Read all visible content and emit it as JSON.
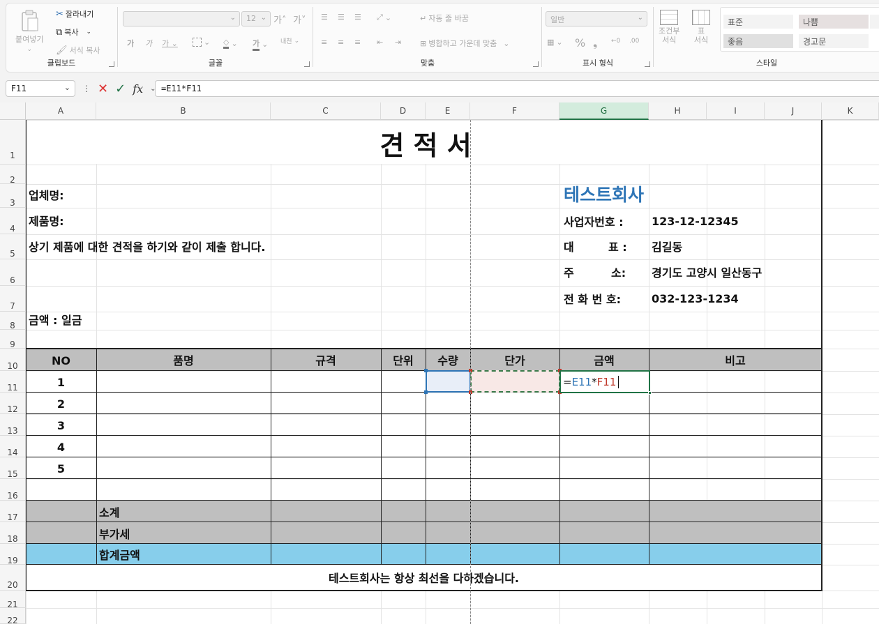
{
  "ribbon": {
    "clipboard": {
      "title": "클립보드",
      "paste": "붙여넣기",
      "cut": "잘라내기",
      "copy": "복사",
      "format_painter": "서식 복사"
    },
    "font": {
      "title": "글꼴",
      "font_name": "",
      "font_size": "12"
    },
    "alignment": {
      "title": "맞춤",
      "wrap_text": "자동 줄 바꿈",
      "merge_center": "병합하고 가운데 맞춤"
    },
    "number": {
      "title": "표시 형식",
      "format": "일반"
    },
    "styles": {
      "title": "스타일",
      "conditional": "조건부\n서식",
      "table_format": "표\n서식",
      "normal": "표준",
      "bad": "나쁨",
      "good": "좋음",
      "warning": "경고문"
    }
  },
  "formula_bar": {
    "name_box": "F11",
    "formula": "=E11*F11"
  },
  "columns": [
    "A",
    "B",
    "C",
    "D",
    "E",
    "F",
    "G",
    "H",
    "I",
    "J",
    "K"
  ],
  "rows": [
    "1",
    "2",
    "3",
    "4",
    "5",
    "6",
    "7",
    "8",
    "9",
    "10",
    "11",
    "12",
    "13",
    "14",
    "15",
    "16",
    "17",
    "18",
    "19",
    "20",
    "21",
    "22"
  ],
  "sheet": {
    "title": "견 적 서",
    "client_label": "업체명:",
    "product_label": "제품명:",
    "intro": "상기 제품에 대한 견적을 하기와 같이 제출 합니다.",
    "amount_label": "금액 : 일금",
    "company": "테스트회사",
    "biz_no_label": "사업자번호 :",
    "biz_no": "123-12-12345",
    "ceo_label_1": "대",
    "ceo_label_2": "표 :",
    "ceo": "김길동",
    "addr_label_1": "주",
    "addr_label_2": "소:",
    "address": "경기도 고양시 일산동구",
    "phone_label": "전 화 번 호:",
    "phone": "032-123-1234",
    "headers": [
      "NO",
      "품명",
      "규격",
      "단위",
      "수량",
      "단가",
      "금액",
      "비고"
    ],
    "row_numbers": [
      "1",
      "2",
      "3",
      "4",
      "5"
    ],
    "editing_formula": {
      "eq": "=",
      "ref1": "E11",
      "op": "*",
      "ref2": "F11"
    },
    "subtotal": "소계",
    "vat": "부가세",
    "total": "합계금액",
    "footer": "테스트회사는 항상 최선을 다하겠습니다."
  },
  "colors": {
    "accent": "#217346",
    "header_gray": "#bfbfbf",
    "total_blue": "#87ceeb",
    "company_blue": "#2e75b6",
    "ref_blue": "#2e75b6",
    "ref_red": "#c0392b"
  }
}
